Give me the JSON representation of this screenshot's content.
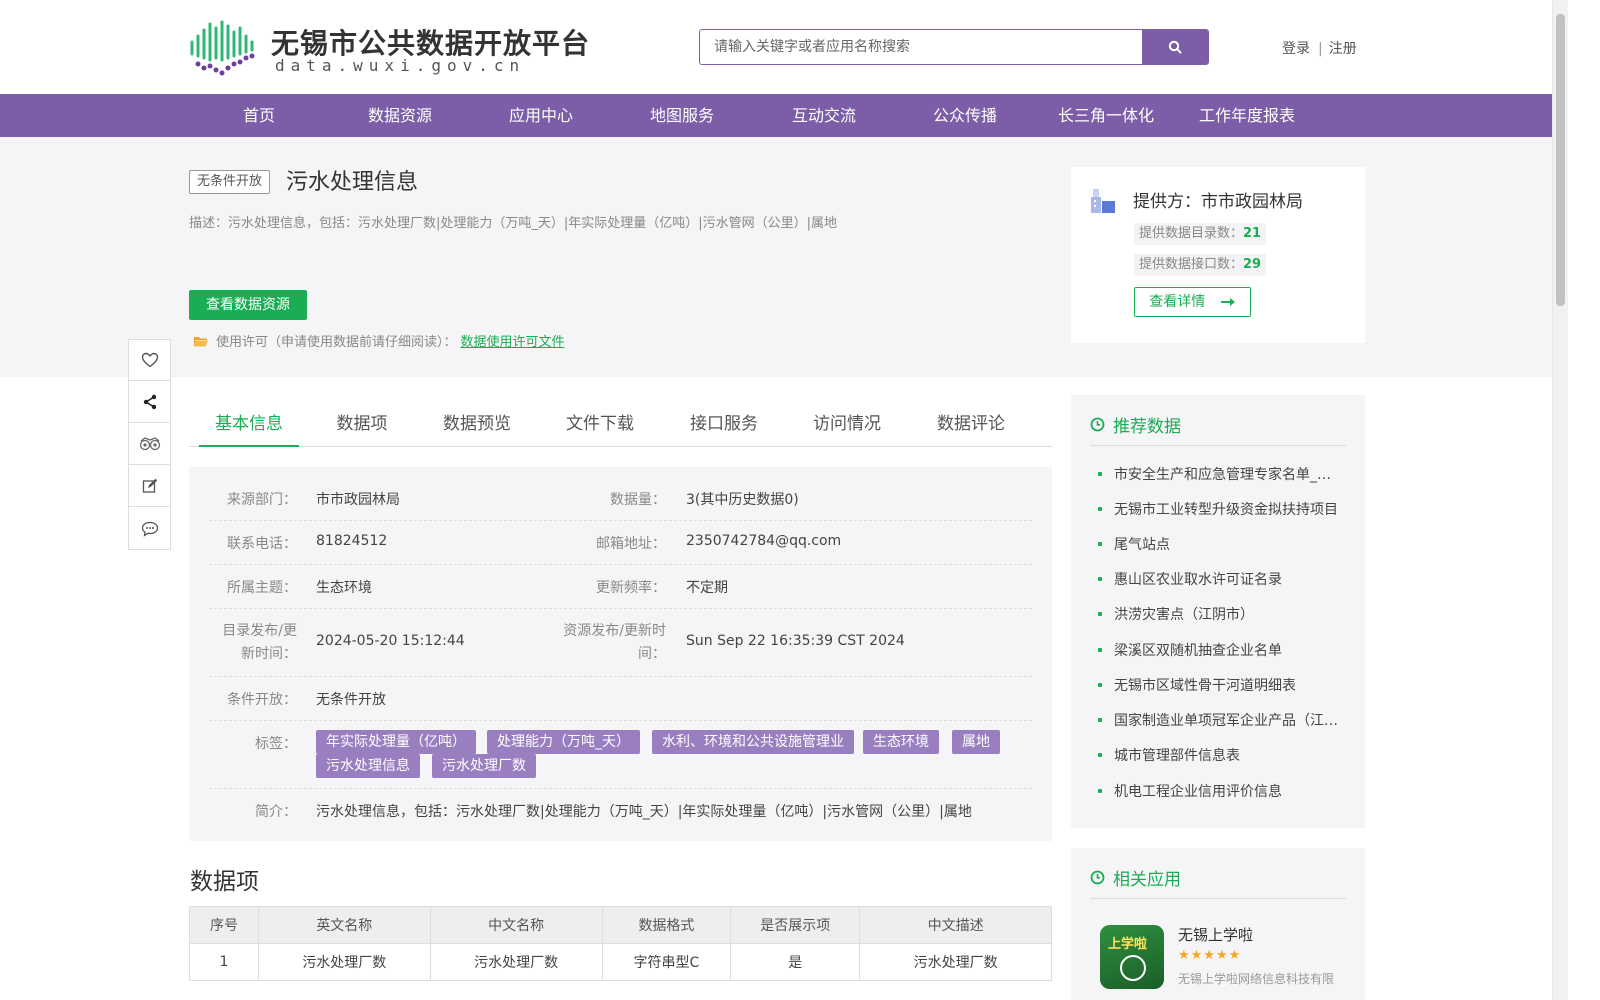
{
  "header": {
    "logo_title": "无锡市公共数据开放平台",
    "logo_subtitle": "data.wuxi.gov.cn",
    "search_placeholder": "请输入关键字或者应用名称搜索",
    "search_value": "",
    "login": "登录",
    "register": "注册",
    "separator": "|"
  },
  "nav": {
    "items": [
      {
        "label": "首页"
      },
      {
        "label": "数据资源"
      },
      {
        "label": "应用中心"
      },
      {
        "label": "地图服务"
      },
      {
        "label": "互动交流"
      },
      {
        "label": "公众传播"
      },
      {
        "label": "长三角一体化"
      },
      {
        "label": "工作年度报表"
      }
    ]
  },
  "dataset": {
    "open_badge": "无条件开放",
    "title": "污水处理信息",
    "description": "描述：污水处理信息，包括：污水处理厂数|处理能力（万吨_天）|年实际处理量（亿吨）|污水管网（公里）|属地",
    "view_button": "查看数据资源",
    "license_text": "使用许可（申请使用数据前请仔细阅读）：",
    "license_link": "数据使用许可文件"
  },
  "provider": {
    "name": "提供方：市市政园林局",
    "catalog_label": "提供数据目录数：",
    "catalog_count": "21",
    "api_label": "提供数据接口数：",
    "api_count": "29",
    "detail_button": "查看详情"
  },
  "side_tools": [
    "heart-icon",
    "share-icon",
    "binoculars-icon",
    "edit-icon",
    "comment-icon"
  ],
  "tabs": [
    {
      "label": "基本信息",
      "active": true
    },
    {
      "label": "数据项",
      "active": false
    },
    {
      "label": "数据预览",
      "active": false
    },
    {
      "label": "文件下载",
      "active": false
    },
    {
      "label": "接口服务",
      "active": false
    },
    {
      "label": "访问情况",
      "active": false
    },
    {
      "label": "数据评论",
      "active": false
    }
  ],
  "info": {
    "source_label": "来源部门：",
    "source_value": "市市政园林局",
    "volume_label": "数据量：",
    "volume_value": "3(其中历史数据0)",
    "phone_label": "联系电话：",
    "phone_value": "81824512",
    "email_label": "邮箱地址：",
    "email_value": "2350742784@qq.com",
    "topic_label": "所属主题：",
    "topic_value": "生态环境",
    "frequency_label": "更新频率：",
    "frequency_value": "不定期",
    "catalog_time_label_1": "目录发布/更",
    "catalog_time_label_2": "新时间：",
    "catalog_time_value": "2024-05-20 15:12:44",
    "resource_time_label_1": "资源发布/更新时",
    "resource_time_label_2": "间：",
    "resource_time_value": "Sun Sep 22 16:35:39 CST 2024",
    "condition_label": "条件开放：",
    "condition_value": "无条件开放",
    "tags_label": "标签：",
    "tags": [
      "年实际处理量（亿吨）",
      "处理能力（万吨_天）",
      "水利、环境和公共设施管理业",
      "生态环境",
      "属地",
      "污水处理信息",
      "污水处理厂数"
    ],
    "intro_label": "简介：",
    "intro_value": "污水处理信息，包括：污水处理厂数|处理能力（万吨_天）|年实际处理量（亿吨）|污水管网（公里）|属地"
  },
  "data_items": {
    "title": "数据项",
    "columns": [
      "序号",
      "英文名称",
      "中文名称",
      "数据格式",
      "是否展示项",
      "中文描述"
    ],
    "rows": [
      [
        "1",
        "污水处理厂数",
        "污水处理厂数",
        "字符串型C",
        "是",
        "污水处理厂数"
      ]
    ]
  },
  "recommended": {
    "title": "推荐数据",
    "items": [
      "市安全生产和应急管理专家名单_政府",
      "无锡市工业转型升级资金拟扶持项目",
      "尾气站点",
      "惠山区农业取水许可证名录",
      "洪涝灾害点（江阴市）",
      "梁溪区双随机抽查企业名单",
      "无锡市区域性骨干河道明细表",
      "国家制造业单项冠军企业产品（江苏）",
      "城市管理部件信息表",
      "机电工程企业信用评价信息"
    ]
  },
  "related_apps": {
    "title": "相关应用",
    "app_name": "无锡上学啦",
    "app_icon_text": "上学啦",
    "app_stars": "★★★★★",
    "app_desc": "无锡上学啦网络信息科技有限"
  },
  "colors": {
    "brand_purple": "#7b5ea7",
    "accent_green": "#1aad54",
    "tag_purple": "#9a7fc0"
  }
}
